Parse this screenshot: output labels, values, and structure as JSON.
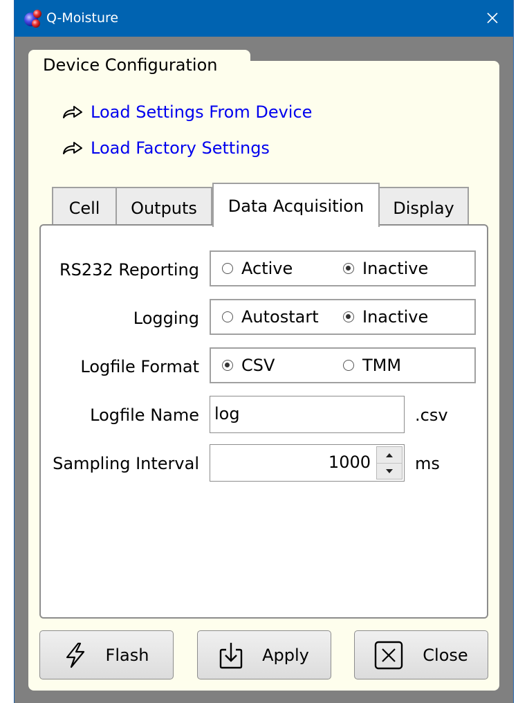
{
  "window": {
    "title": "Q-Moisture",
    "icons": {
      "app": "molecule-app-icon",
      "close": "close-icon"
    }
  },
  "panel": {
    "title": "Device Configuration",
    "links": [
      {
        "label": "Load Settings From Device",
        "icon": "redo-arrow-icon"
      },
      {
        "label": "Load Factory Settings",
        "icon": "redo-arrow-icon"
      }
    ]
  },
  "tabs": [
    {
      "label": "Cell",
      "active": false
    },
    {
      "label": "Outputs",
      "active": false
    },
    {
      "label": "Data Acquisition",
      "active": true
    },
    {
      "label": "Display",
      "active": false
    }
  ],
  "form": {
    "rs232": {
      "label": "RS232 Reporting",
      "options": [
        "Active",
        "Inactive"
      ],
      "selected": "Inactive"
    },
    "logging": {
      "label": "Logging",
      "options": [
        "Autostart",
        "Inactive"
      ],
      "selected": "Inactive"
    },
    "logfile_format": {
      "label": "Logfile Format",
      "options": [
        "CSV",
        "TMM"
      ],
      "selected": "CSV"
    },
    "logfile_name": {
      "label": "Logfile Name",
      "value": "log",
      "suffix": ".csv"
    },
    "sampling_interval": {
      "label": "Sampling Interval",
      "value": "1000",
      "unit": "ms"
    }
  },
  "buttons": {
    "flash": {
      "label": "Flash",
      "icon": "lightning-icon"
    },
    "apply": {
      "label": "Apply",
      "icon": "download-tray-icon"
    },
    "close": {
      "label": "Close",
      "icon": "close-box-icon"
    }
  },
  "colors": {
    "titlebar": "#0063b1",
    "panel_bg": "#fefeed",
    "link": "#0000ee",
    "frame": "#808080"
  }
}
